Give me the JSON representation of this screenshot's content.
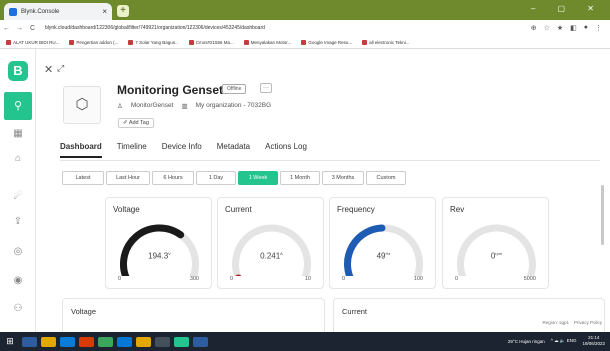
{
  "browser": {
    "tab_title": "Blynk.Console",
    "tab_close": "×",
    "new_tab": "+",
    "window_controls": "–  ▢  ✕",
    "back": "←",
    "forward": "→",
    "reload": "C",
    "url": "blynk.cloud/dashboard/122306/global/filter/749921/organization/122306/devices/453245/dashboard",
    "addr_icons": [
      "⊕",
      "☆",
      "★",
      "◧",
      "●",
      "⋮"
    ],
    "bookmarks": [
      "ALAT UKUR BIDI RU...",
      "Pengertian addon (...",
      "7 Solar Yang Bagus...",
      "Cmos#21556 Ma...",
      "Menyalakan Motor...",
      "Google Image Resu...",
      "all electronic Tekni..."
    ]
  },
  "sidebar": {
    "logo": "B",
    "search_icon": "⚲",
    "icons": [
      "▦",
      "⌂",
      "☄",
      "⇪",
      "◎",
      "◉",
      "⚇"
    ]
  },
  "header": {
    "close": "✕",
    "expand": "⤢",
    "device_icon": "⬡",
    "title": "Monitoring Genset",
    "status": "Offline",
    "more": "···",
    "owner_icon": "♙",
    "owner": "MonitorGenset",
    "org_icon": "▥",
    "organization": "My organization - 7032BG",
    "add_tag": "✐ Add Tag"
  },
  "tabs": [
    "Dashboard",
    "Timeline",
    "Device Info",
    "Metadata",
    "Actions Log"
  ],
  "ranges": [
    "Latest",
    "Last Hour",
    "6 Hours",
    "1 Day",
    "1 Week",
    "1 Month",
    "3 Months",
    "Custom"
  ],
  "active_range": "1 Week",
  "gauges": [
    {
      "title": "Voltage",
      "value": "194.3",
      "unit": "V",
      "min": "0",
      "max": "300",
      "fraction": 0.65,
      "color": "#1a1a1a"
    },
    {
      "title": "Current",
      "value": "0.241",
      "unit": "A",
      "min": "0",
      "max": "10",
      "fraction": 0.03,
      "color": "#b71c1c"
    },
    {
      "title": "Frequency",
      "value": "49",
      "unit": "Hz",
      "min": "0",
      "max": "100",
      "fraction": 0.49,
      "color": "#1e5bb5"
    },
    {
      "title": "Rev",
      "value": "0",
      "unit": "rpm",
      "min": "0",
      "max": "5000",
      "fraction": 0.0,
      "color": "#cccccc"
    }
  ],
  "bottom_cards": [
    "Voltage",
    "Current"
  ],
  "footer": [
    "Region: sgp1",
    "Privacy Policy"
  ],
  "taskbar": {
    "start": "⊞",
    "apps": [
      "#2d5d9f",
      "#e0a800",
      "#0a7cd8",
      "#d83b01",
      "#3aa55d",
      "#0078d4",
      "#e0a800",
      "#444f5c",
      "#23c48e",
      "#2d5d9f"
    ],
    "weather": "29°C Hujan ringan",
    "tray_icons": "^  ☁  🔈  ENG",
    "time": "21:14",
    "date": "19/06/2022"
  }
}
